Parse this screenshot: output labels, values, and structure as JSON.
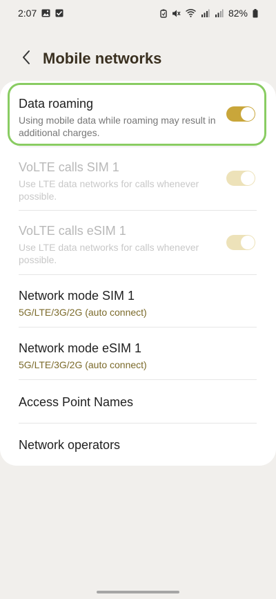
{
  "status_bar": {
    "time": "2:07",
    "battery": "82%",
    "icons": [
      "gallery-icon",
      "checkbox-icon",
      "battery-saver-icon",
      "mute-icon",
      "wifi-icon",
      "signal-icon",
      "signal-icon",
      "battery-icon"
    ]
  },
  "header": {
    "title": "Mobile networks",
    "back_icon": "chevron-left-icon"
  },
  "settings": [
    {
      "title": "Data roaming",
      "subtitle": "Using mobile data while roaming may result in additional charges.",
      "toggle": true,
      "enabled": true,
      "highlighted": true
    },
    {
      "title": "VoLTE calls SIM 1",
      "subtitle": "Use LTE data networks for calls whenever possible.",
      "toggle": true,
      "enabled": false
    },
    {
      "title": "VoLTE calls eSIM 1",
      "subtitle": "Use LTE data networks for calls whenever possible.",
      "toggle": true,
      "enabled": false
    },
    {
      "title": "Network mode SIM 1",
      "subtitle": "5G/LTE/3G/2G (auto connect)"
    },
    {
      "title": "Network mode eSIM 1",
      "subtitle": "5G/LTE/3G/2G (auto connect)"
    },
    {
      "title": "Access Point Names"
    },
    {
      "title": "Network operators"
    }
  ],
  "colors": {
    "accent": "#c9a63a",
    "highlight_border": "#89cc62",
    "mode_text": "#7b6a2a"
  }
}
